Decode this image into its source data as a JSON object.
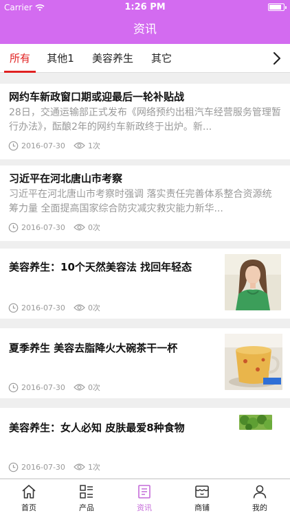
{
  "status_bar": {
    "carrier": "Carrier",
    "time": "1:26 PM",
    "battery_level": 0.9
  },
  "header": {
    "title": "资讯"
  },
  "tabs": [
    {
      "label": "所有",
      "active": true
    },
    {
      "label": "其他1",
      "active": false
    },
    {
      "label": "美容养生",
      "active": false
    },
    {
      "label": "其它",
      "active": false
    }
  ],
  "icons": {
    "wifi": "wifi-icon",
    "more": "chevron-right-icon",
    "clock": "clock-icon",
    "eye": "eye-icon",
    "tabbar": [
      "home-icon",
      "grid-list-icon",
      "document-icon",
      "store-icon",
      "user-icon"
    ]
  },
  "colors": {
    "accent": "#d36bf0",
    "tab_active": "#e02020",
    "tabbar_active": "#c46ad9",
    "muted": "#999999"
  },
  "articles": [
    {
      "title": "网约车新政窗口期或迎最后一轮补贴战",
      "summary": "28日，交通运输部正式发布《网络预约出租汽车经营服务管理暂行办法》，酝酿2年的网约车新政终于出炉。新...",
      "date": "2016-07-30",
      "views": "1次"
    },
    {
      "title": "习近平在河北唐山市考察",
      "summary": "习近平在河北唐山市考察时强调 落实责任完善体系整合资源统筹力量 全面提高国家综合防灾减灾救灾能力新华...",
      "date": "2016-07-30",
      "views": "0次"
    },
    {
      "title": "美容养生：10个天然美容法 找回年轻态",
      "date": "2016-07-30",
      "views": "0次",
      "thumbnail": "woman-portrait-photo"
    },
    {
      "title": "夏季养生 美容去脂降火大碗茶干一杯",
      "date": "2016-07-30",
      "views": "0次",
      "thumbnail": "glass-of-tea-photo"
    },
    {
      "title": "美容养生：女人必知 皮肤最爱8种食物",
      "date": "2016-07-30",
      "views": "1次",
      "thumbnail": "broccoli-photo"
    }
  ],
  "tabbar": [
    {
      "label": "首页",
      "active": false
    },
    {
      "label": "产品",
      "active": false
    },
    {
      "label": "资讯",
      "active": true
    },
    {
      "label": "商铺",
      "active": false
    },
    {
      "label": "我的",
      "active": false
    }
  ]
}
